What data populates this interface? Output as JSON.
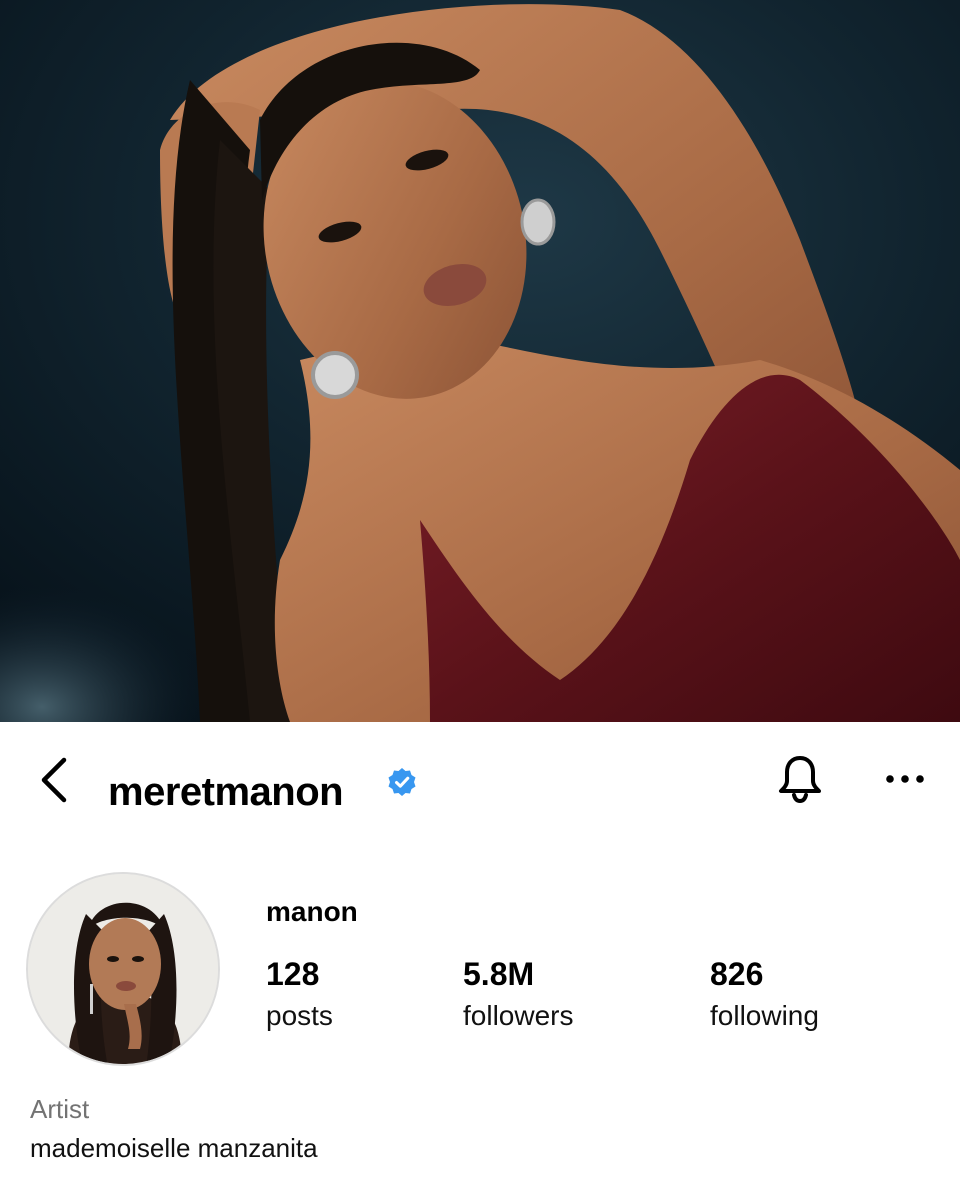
{
  "cover_photo": {
    "icon": "cover-photo",
    "description_shown": false
  },
  "header": {
    "username": "meretmanon",
    "verified": true,
    "verified_color": "#3897f0",
    "back_icon": "chevron-left-icon",
    "notify_icon": "bell-icon",
    "more_icon": "ellipsis-icon"
  },
  "profile": {
    "display_name": "manon",
    "stats": [
      {
        "value": "128",
        "label": "posts"
      },
      {
        "value": "5.8M",
        "label": "followers"
      },
      {
        "value": "826",
        "label": "following"
      }
    ],
    "category": "Artist",
    "bio": "mademoiselle manzanita"
  },
  "colors": {
    "text": "#000000",
    "secondary_text": "#737373",
    "background": "#ffffff"
  }
}
